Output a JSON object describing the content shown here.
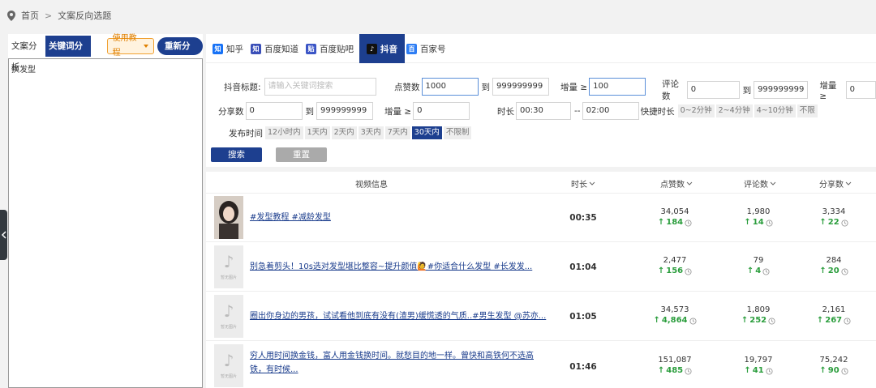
{
  "breadcrumb": {
    "home": "首页",
    "separator": ">",
    "current": "文案反向选题"
  },
  "left_panel": {
    "tabs": [
      "文案分析",
      "关键词分析"
    ],
    "guide_button": "使用教程",
    "reanalyze_button": "重新分析",
    "textarea_value": "换发型"
  },
  "platform_tabs": [
    {
      "label": "知乎",
      "icon": "zhihu-icon",
      "color": "#1772f6",
      "glyph": "知"
    },
    {
      "label": "百度知道",
      "icon": "baidu-zhidao-icon",
      "color": "#3a4fb8",
      "glyph": "知"
    },
    {
      "label": "百度贴吧",
      "icon": "baidu-tieba-icon",
      "color": "#3b55c6",
      "glyph": "贴"
    },
    {
      "label": "抖音",
      "icon": "douyin-icon",
      "color": "#111111",
      "glyph": "♪"
    },
    {
      "label": "百家号",
      "icon": "baijiahao-icon",
      "color": "#2d7df4",
      "glyph": "百"
    }
  ],
  "filters": {
    "title_label": "抖音标题:",
    "title_placeholder": "请输入关键词搜索",
    "likes_label": "点赞数",
    "likes_min": "1000",
    "to": "到",
    "likes_max": "999999999",
    "growth_label": "增量 ≥",
    "likes_growth": "100",
    "comments_label": "评论数",
    "comments_min": "0",
    "comments_max": "999999999",
    "comments_growth": "0",
    "shares_label": "分享数",
    "shares_min": "0",
    "shares_max": "999999999",
    "shares_growth": "0",
    "duration_label": "时长",
    "duration_min": "00:30",
    "duration_dash": "--",
    "duration_max": "02:00",
    "quick_duration_label": "快捷时长",
    "quick_durations": [
      "0~2分钟",
      "2~4分钟",
      "4~10分钟",
      "不限"
    ],
    "publish_label": "发布时间",
    "publish_options": [
      "12小时内",
      "1天内",
      "2天内",
      "3天内",
      "7天内",
      "30天内",
      "不限制"
    ],
    "publish_selected": "30天内",
    "search_button": "搜索",
    "reset_button": "重置"
  },
  "table": {
    "headers": {
      "video": "视频信息",
      "duration": "时长",
      "likes": "点赞数",
      "comments": "评论数",
      "shares": "分享数"
    },
    "placeholder_thumb_text": "暂无图片",
    "rows": [
      {
        "title": "#发型教程 #减龄发型",
        "duration": "00:35",
        "likes": "34,054",
        "likes_growth": "184",
        "comments": "1,980",
        "comments_growth": "14",
        "shares": "3,334",
        "shares_growth": "22",
        "thumb": "photo"
      },
      {
        "title": "别急着剪头！10s选对发型堪比整容~提升颜值🙋#你适合什么发型 #长发发...",
        "duration": "01:04",
        "likes": "2,477",
        "likes_growth": "156",
        "comments": "79",
        "comments_growth": "4",
        "shares": "284",
        "shares_growth": "20",
        "thumb": "placeholder"
      },
      {
        "title": "圈出你身边的男孩，试试看他到底有没有(渣男)缓慌透的气质..#男生发型 @苏亦...",
        "duration": "01:05",
        "likes": "34,573",
        "likes_growth": "4,864",
        "comments": "1,809",
        "comments_growth": "252",
        "shares": "2,161",
        "shares_growth": "267",
        "thumb": "placeholder"
      },
      {
        "title": "穷人用时间换金钱，富人用金钱换时间。就愁目的地一样。曾快和高铁何不选高铁，有时候...",
        "duration": "01:46",
        "likes": "151,087",
        "likes_growth": "485",
        "comments": "19,797",
        "comments_growth": "41",
        "shares": "75,242",
        "shares_growth": "90",
        "thumb": "placeholder"
      }
    ]
  },
  "colors": {
    "primary": "#1d3f8f",
    "growth": "#2a9d3c",
    "link": "#1a3c8c",
    "guide": "#e08000"
  }
}
